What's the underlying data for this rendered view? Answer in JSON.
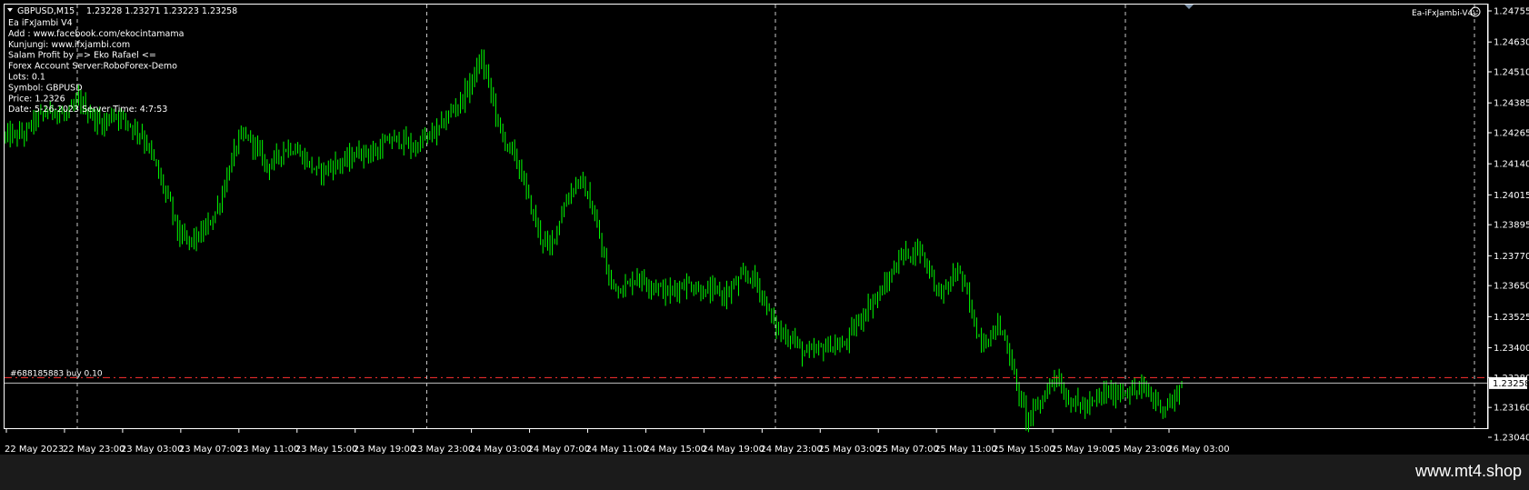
{
  "chart_header": {
    "symbol_timeframe": "GBPUSD,M15",
    "ohlc": "1.23228 1.23271 1.23223 1.23258"
  },
  "info_panel": {
    "lines": [
      "Ea iFxJambi V4",
      "Add : www.facebook.com/ekocintamama",
      "Kunjungi: www.ifxjambi.com",
      "Salam Profit by => Eko Rafael <=",
      "Forex Account Server:RoboForex-Demo",
      "Lots:  0.1",
      "Symbol: GBPUSD",
      "Price:  1.2326",
      "Date: 5-26-2023 Server Time: 4:7:53"
    ]
  },
  "ea_label": "Ea-iFxJambi-V4",
  "trade_label": "#688185883 buy 0.10",
  "colors": {
    "background": "#000000",
    "candle": "#00ff00",
    "trade_line": "#ff3030",
    "bid_line": "#c0c0c0",
    "grid": "#c8c8c8",
    "text": "#ffffff"
  },
  "chart_data": {
    "type": "candlestick",
    "symbol": "GBPUSD",
    "timeframe": "M15",
    "grid": "vertical dashed separators",
    "price_axis": {
      "position": "right",
      "ticks": [
        "1.24755",
        "1.24630",
        "1.24510",
        "1.24385",
        "1.24265",
        "1.24140",
        "1.24015",
        "1.23895",
        "1.23770",
        "1.23650",
        "1.23525",
        "1.23400",
        "1.23280",
        "1.23160",
        "1.23040"
      ],
      "range": [
        1.2301,
        1.2477
      ]
    },
    "time_axis": {
      "position": "bottom",
      "ticks": [
        "22 May 2023",
        "22 May 23:00",
        "23 May 03:00",
        "23 May 07:00",
        "23 May 11:00",
        "23 May 15:00",
        "23 May 19:00",
        "23 May 23:00",
        "24 May 03:00",
        "24 May 07:00",
        "24 May 11:00",
        "24 May 15:00",
        "24 May 19:00",
        "24 May 23:00",
        "25 May 03:00",
        "25 May 07:00",
        "25 May 11:00",
        "25 May 15:00",
        "25 May 19:00",
        "25 May 23:00",
        "26 May 03:00"
      ]
    },
    "current_bid": "1.23258",
    "trade_open_price": 1.2328,
    "close_path": [
      [
        0,
        1.2425
      ],
      [
        2,
        1.2426
      ],
      [
        3,
        1.2432
      ],
      [
        4,
        1.2434
      ],
      [
        5,
        1.2436
      ],
      [
        6,
        1.2433
      ],
      [
        7,
        1.2436
      ],
      [
        7.5,
        1.244
      ],
      [
        8,
        1.2437
      ],
      [
        9,
        1.2433
      ],
      [
        10,
        1.243
      ],
      [
        11,
        1.2434
      ],
      [
        12,
        1.2433
      ],
      [
        13,
        1.2429
      ],
      [
        14,
        1.2426
      ],
      [
        15,
        1.2418
      ],
      [
        16,
        1.2407
      ],
      [
        17,
        1.2397
      ],
      [
        17.5,
        1.239
      ],
      [
        18,
        1.2384
      ],
      [
        19,
        1.2383
      ],
      [
        20,
        1.2385
      ],
      [
        21,
        1.239
      ],
      [
        22,
        1.2398
      ],
      [
        23,
        1.2412
      ],
      [
        24,
        1.2424
      ],
      [
        25,
        1.2425
      ],
      [
        26,
        1.2419
      ],
      [
        27,
        1.2413
      ],
      [
        28,
        1.2417
      ],
      [
        29,
        1.2421
      ],
      [
        30,
        1.2419
      ],
      [
        31,
        1.2415
      ],
      [
        32,
        1.2411
      ],
      [
        33,
        1.2412
      ],
      [
        34,
        1.2414
      ],
      [
        35,
        1.2415
      ],
      [
        36,
        1.2418
      ],
      [
        37,
        1.2419
      ],
      [
        38,
        1.2418
      ],
      [
        39,
        1.2422
      ],
      [
        40,
        1.2424
      ],
      [
        41,
        1.2423
      ],
      [
        42,
        1.242
      ],
      [
        43,
        1.2424
      ],
      [
        44,
        1.2426
      ],
      [
        45,
        1.243
      ],
      [
        46,
        1.2436
      ],
      [
        47,
        1.244
      ],
      [
        48,
        1.2448
      ],
      [
        49,
        1.2456
      ],
      [
        50,
        1.2442
      ],
      [
        51,
        1.2425
      ],
      [
        52,
        1.242
      ],
      [
        53,
        1.2411
      ],
      [
        54,
        1.2397
      ],
      [
        55,
        1.2385
      ],
      [
        56,
        1.238
      ],
      [
        57,
        1.2392
      ],
      [
        58,
        1.2402
      ],
      [
        59,
        1.2408
      ],
      [
        60,
        1.24
      ],
      [
        61,
        1.2386
      ],
      [
        62,
        1.2368
      ],
      [
        63,
        1.2364
      ],
      [
        64,
        1.2365
      ],
      [
        65,
        1.2369
      ],
      [
        66,
        1.2366
      ],
      [
        67,
        1.2365
      ],
      [
        68,
        1.2362
      ],
      [
        69,
        1.2364
      ],
      [
        70,
        1.2366
      ],
      [
        71,
        1.2364
      ],
      [
        72,
        1.2362
      ],
      [
        73,
        1.2363
      ],
      [
        74,
        1.2361
      ],
      [
        75,
        1.2365
      ],
      [
        76,
        1.2369
      ],
      [
        77,
        1.2368
      ],
      [
        78,
        1.236
      ],
      [
        79,
        1.235
      ],
      [
        80,
        1.2345
      ],
      [
        81,
        1.2344
      ],
      [
        82,
        1.2338
      ],
      [
        83,
        1.2338
      ],
      [
        84,
        1.234
      ],
      [
        85,
        1.2341
      ],
      [
        86,
        1.234
      ],
      [
        87,
        1.2346
      ],
      [
        88,
        1.2352
      ],
      [
        89,
        1.2358
      ],
      [
        90,
        1.2362
      ],
      [
        91,
        1.2368
      ],
      [
        92,
        1.2377
      ],
      [
        93,
        1.2378
      ],
      [
        94,
        1.238
      ],
      [
        95,
        1.2372
      ],
      [
        96,
        1.2362
      ],
      [
        97,
        1.2365
      ],
      [
        98,
        1.2372
      ],
      [
        99,
        1.236
      ],
      [
        100,
        1.2345
      ],
      [
        101,
        1.2342
      ],
      [
        102,
        1.235
      ],
      [
        103,
        1.2342
      ],
      [
        104,
        1.2325
      ],
      [
        105,
        1.2312
      ],
      [
        106,
        1.2315
      ],
      [
        107,
        1.2322
      ],
      [
        108,
        1.233
      ],
      [
        109,
        1.232
      ],
      [
        110,
        1.2318
      ],
      [
        111,
        1.2316
      ],
      [
        112,
        1.2318
      ],
      [
        113,
        1.2322
      ],
      [
        114,
        1.2321
      ],
      [
        115,
        1.2323
      ],
      [
        116,
        1.2322
      ],
      [
        117,
        1.2324
      ],
      [
        118,
        1.232
      ],
      [
        119,
        1.2316
      ],
      [
        120,
        1.2318
      ],
      [
        121,
        1.2326
      ]
    ]
  },
  "footer": {
    "watermark": "www.mt4.shop"
  }
}
